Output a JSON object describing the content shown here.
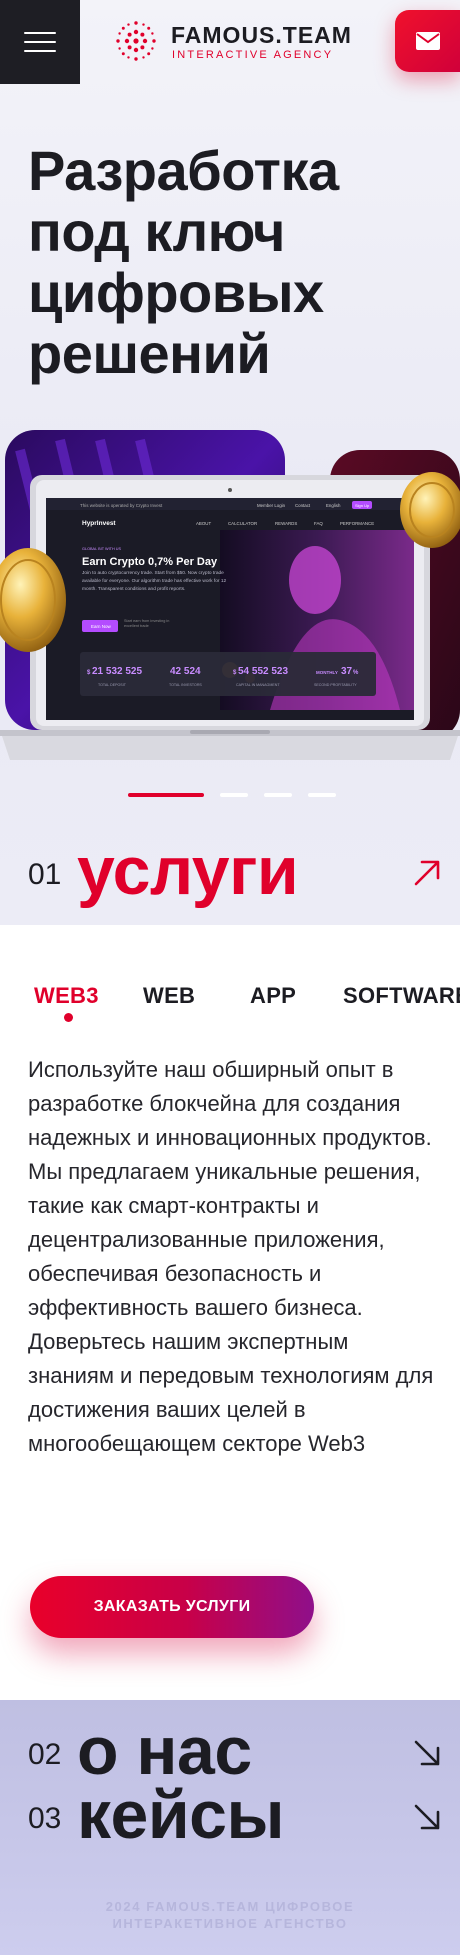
{
  "header": {
    "logo_title": "FAMOUS.TEAM",
    "logo_subtitle": "INTERACTIVE AGENCY",
    "brand_color": "#e0002b",
    "menu_icon": "hamburger-icon",
    "mail_icon": "envelope-icon"
  },
  "hero": {
    "title": "Разработка под ключ цифровых решений",
    "mockup": {
      "notice": "This website is operated by Crypto Invest",
      "brand": "HyprInvest",
      "nav": [
        "ABOUT",
        "CALCULATOR",
        "REWARDS",
        "FAQ",
        "PERFORMANCE"
      ],
      "member_login": "Member Login",
      "contact": "Contact",
      "language": "English",
      "sign_up": "Sign Up",
      "eyebrow": "GLOBAL BIT WITH US",
      "headline": "Earn Crypto 0,7% Per Day",
      "body": "Join to auto cryptocurrency trade. Start from $50. Now crypto trade available for everyone. Our algorithm trade has effective work for 12 month. Transparent conditions and profit reports.",
      "cta": "Earn Now",
      "cta_note": "Start earn from investing in excellent trade",
      "stats": [
        {
          "value": "21 532 525",
          "prefix": "$",
          "label": "TOTAL DEPOSIT"
        },
        {
          "value": "42 524",
          "prefix": "",
          "label": "TOTAL INVESTORS"
        },
        {
          "value": "54 552 523",
          "prefix": "$",
          "label": "CAPITAL IN MANAGMENT"
        },
        {
          "value": "37",
          "prefix": "MONTHLY",
          "suffix": "%",
          "label": "SECOND PROFITABILITY"
        }
      ]
    },
    "slider": {
      "count": 4,
      "active_index": 0
    }
  },
  "services": {
    "number": "01",
    "title": "услуги",
    "arrow_icon": "arrow-up-right-icon",
    "tabs": [
      "WEB3",
      "WEB",
      "APP",
      "SOFTWARE"
    ],
    "active_tab": "WEB3",
    "description": "Используйте наш обширный опыт в разработке блокчейна для создания надежных и инновационных продуктов. Мы предлагаем уникальные решения, такие как смарт-контракты и децентрализованные приложения, обеспечивая безопасность и эффективность вашего бизнеса. Доверьтесь нашим экспертным знаниям и передовым технологиям для достижения ваших целей в многообещающем секторе Web3",
    "order_button": "ЗАКАЗАТЬ УСЛУГИ"
  },
  "sections": [
    {
      "number": "02",
      "title": "о нас",
      "arrow_icon": "arrow-down-right-icon"
    },
    {
      "number": "03",
      "title": "кейсы",
      "arrow_icon": "arrow-down-right-icon"
    }
  ],
  "footer": {
    "copyright": "2024 FAMOUS.TEAM ЦИФРОВОЕ ИНТЕРАКЕТИВНОЕ АГЕНСТВО"
  }
}
